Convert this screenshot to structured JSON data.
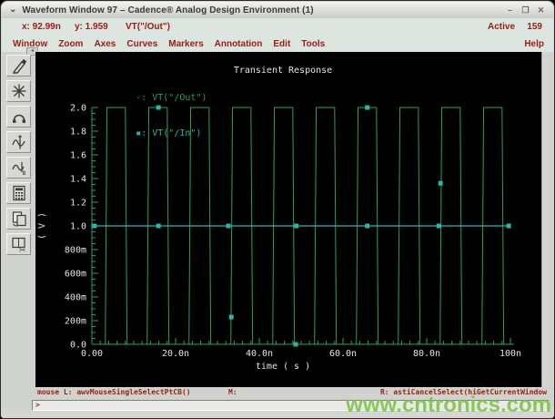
{
  "window": {
    "title": "Waveform Window 97 – Cadence® Analog Design Environment (1)",
    "menu_glyph": "⌄",
    "controls": {
      "minimize": "–",
      "maximize": "❐",
      "close": "✕"
    }
  },
  "info_bar": {
    "x": "x: 92.99n",
    "y": "y: 1.959",
    "trace": "VT(\"/Out\")",
    "active_label": "Active",
    "active_count": "159"
  },
  "menu_bar": {
    "items": [
      "Window",
      "Zoom",
      "Axes",
      "Curves",
      "Markers",
      "Annotation",
      "Edit",
      "Tools"
    ],
    "help": "Help"
  },
  "toolbar": {
    "buttons": [
      "select-probe",
      "zoom-fit",
      "pan-strip",
      "vertical-marker",
      "subwindow-b-marker",
      "calculator",
      "copy-window",
      "split-window"
    ]
  },
  "status_bar": {
    "left_binding": "mouse L: awvMouseSingleSelectPtCB()",
    "middle_binding": "M:",
    "right_binding": "R: astiCancelSelect(hiGetCurrentWindow",
    "prompt": ">"
  },
  "watermark": "www.cntronics.com",
  "chart_data": {
    "type": "line",
    "title": "Transient Response",
    "xlabel": "time ( s )",
    "ylabel": "( V )",
    "x_unit": "ns",
    "xlim": [
      0,
      100
    ],
    "ylim": [
      0,
      2
    ],
    "grid": false,
    "axis_color": "#2d9f6b",
    "text_color": "#e4e4e4",
    "x_ticks": {
      "major_labels": [
        "0.00",
        "20.0n",
        "40.0n",
        "60.0n",
        "80.0n",
        "100n"
      ],
      "major_step": 20,
      "minor_step": 2
    },
    "y_ticks": {
      "major_labels": [
        "0.0",
        "200m",
        "400m",
        "600m",
        "800m",
        "1.0",
        "1.2",
        "1.4",
        "1.6",
        "1.8",
        "2.0"
      ],
      "major_step": 0.2,
      "minor_step": 0.05
    },
    "series": [
      {
        "name": "VT(\"/Out\")",
        "legend_marker": "-",
        "color": "#2f9e5a",
        "kind": "pulse-train",
        "low": 0.0,
        "high": 2.0,
        "period": 10,
        "cycles": 10,
        "rise_start": 3.2,
        "rise_end": 3.6,
        "fall_start": 8.0,
        "fall_end": 8.4
      },
      {
        "name": "VT(\"/In\")",
        "legend_marker": "▪",
        "color": "#2fb3a8",
        "kind": "constant",
        "value": 1.0,
        "marker_times": [
          0.6,
          15.9,
          32.6,
          48.8,
          65.8,
          82.9,
          99.6
        ]
      }
    ],
    "point_markers": {
      "color": "#2fb3a8",
      "points": [
        [
          15.9,
          2.0
        ],
        [
          33.3,
          0.23
        ],
        [
          48.7,
          0.0
        ],
        [
          65.8,
          2.0
        ],
        [
          83.3,
          1.36
        ]
      ]
    }
  }
}
